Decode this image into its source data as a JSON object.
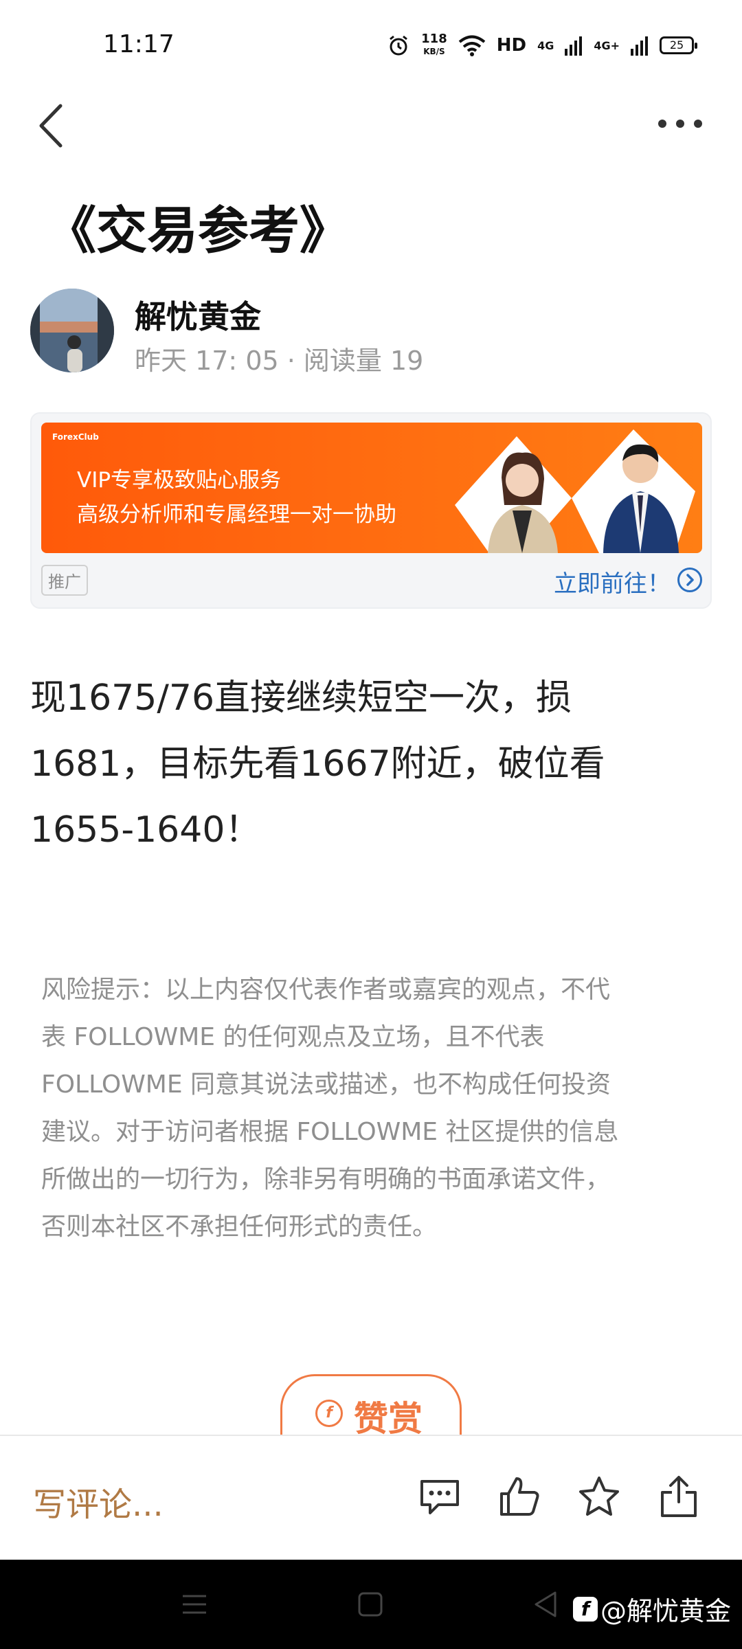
{
  "status_bar": {
    "time": "11:17",
    "net_speed": "118",
    "net_unit": "KB/S",
    "hd": "HD",
    "net1": "4G",
    "net2": "4G+",
    "battery": "25"
  },
  "article": {
    "title": "《交易参考》",
    "author": "解忧黄金",
    "meta": "昨天 17: 05 · 阅读量 19",
    "body_lines": [
      "现1675/76直接继续短空一次，损",
      "1681，目标先看1667附近，破位看",
      "1655-1640！"
    ],
    "risk_lines": [
      "风险提示：以上内容仅代表作者或嘉宾的观点，不代",
      "表 FOLLOWME 的任何观点及立场，且不代表",
      "FOLLOWME 同意其说法或描述，也不构成任何投资",
      "建议。对于访问者根据 FOLLOWME 社区提供的信息",
      "所做出的一切行为，除非另有明确的书面承诺文件，",
      "否则本社区不承担任何形式的责任。"
    ]
  },
  "ad": {
    "brand": "ForexClub",
    "line1": "VIP专享极致贴心服务",
    "line2": "高级分析师和专属经理一对一协助",
    "tag": "推广",
    "cta": "立即前往！"
  },
  "tip": {
    "label": "赞赏",
    "icon_glyph": "f"
  },
  "action_bar": {
    "comment_placeholder": "写评论..."
  },
  "watermark": {
    "logo_glyph": "f",
    "text": "@解忧黄金"
  },
  "colors": {
    "accent_orange": "#f07a44",
    "link_blue": "#2a6fc0",
    "comment_brown": "#b07a45",
    "ad_orange": "#ff6a10"
  },
  "icons": [
    "back-arrow-icon",
    "more-dots-icon",
    "alarm-icon",
    "wifi-icon",
    "signal-icon",
    "comment-icon",
    "like-icon",
    "star-icon",
    "share-icon",
    "menu-icon",
    "home-icon",
    "back-triangle-icon"
  ]
}
